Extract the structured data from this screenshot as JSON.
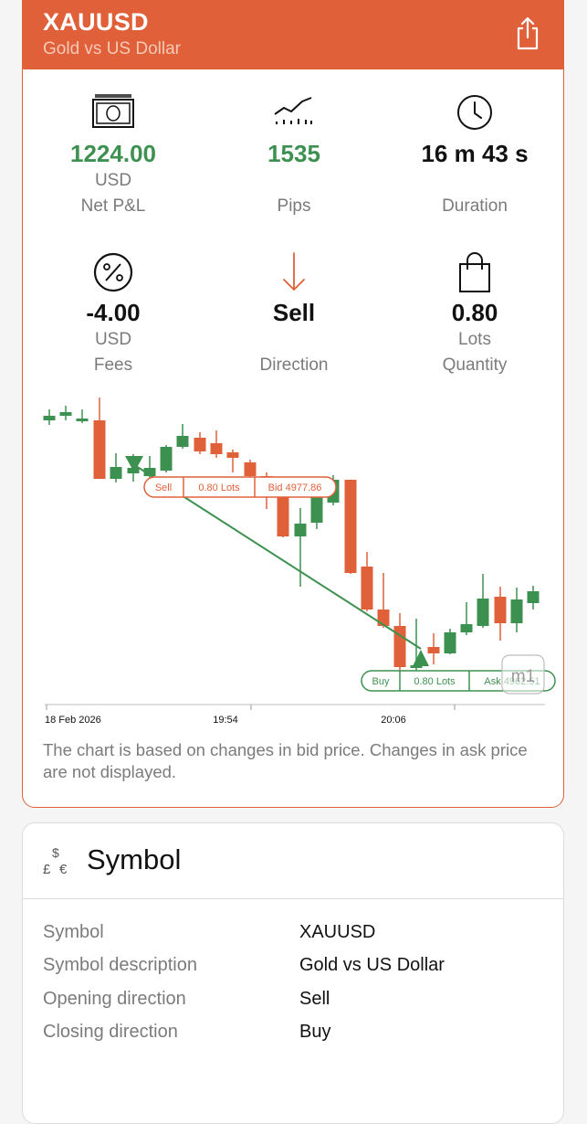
{
  "header": {
    "title": "XAUUSD",
    "subtitle": "Gold vs US Dollar",
    "share_icon": "share-icon"
  },
  "stats": {
    "net_pl": {
      "value": "1224.00",
      "unit": "USD",
      "label": "Net P&L",
      "icon": "cash-icon",
      "color": "#3d9150"
    },
    "pips": {
      "value": "1535",
      "label": "Pips",
      "icon": "trend-chart-icon",
      "color": "#3d9150"
    },
    "duration": {
      "value": "16 m 43 s",
      "label": "Duration",
      "icon": "clock-icon"
    },
    "fees": {
      "value": "-4.00",
      "unit": "USD",
      "label": "Fees",
      "icon": "percent-icon"
    },
    "direction": {
      "value": "Sell",
      "label": "Direction",
      "icon": "arrow-down-icon",
      "icon_color": "#e0603a"
    },
    "quantity": {
      "value": "0.80",
      "unit": "Lots",
      "label": "Quantity",
      "icon": "shopping-bag-icon"
    }
  },
  "chart": {
    "x_labels": [
      "18 Feb 2026",
      "19:54",
      "20:06"
    ],
    "timeframe": "m1",
    "sell_tag": {
      "side": "Sell",
      "lots": "0.80 Lots",
      "price": "Bid 4977.86"
    },
    "buy_tag": {
      "side": "Buy",
      "lots": "0.80 Lots",
      "price": "Ask 4962.51"
    },
    "note": "The chart is based on changes in bid price. Changes in ask price are not displayed.",
    "colors": {
      "up": "#3d9150",
      "down": "#e0603a"
    }
  },
  "symbol": {
    "title": "Symbol",
    "icon": "currency-icon",
    "rows": [
      {
        "key": "Symbol",
        "value": "XAUUSD"
      },
      {
        "key": "Symbol description",
        "value": "Gold vs US Dollar"
      },
      {
        "key": "Opening direction",
        "value": "Sell"
      },
      {
        "key": "Closing direction",
        "value": "Buy"
      }
    ]
  }
}
